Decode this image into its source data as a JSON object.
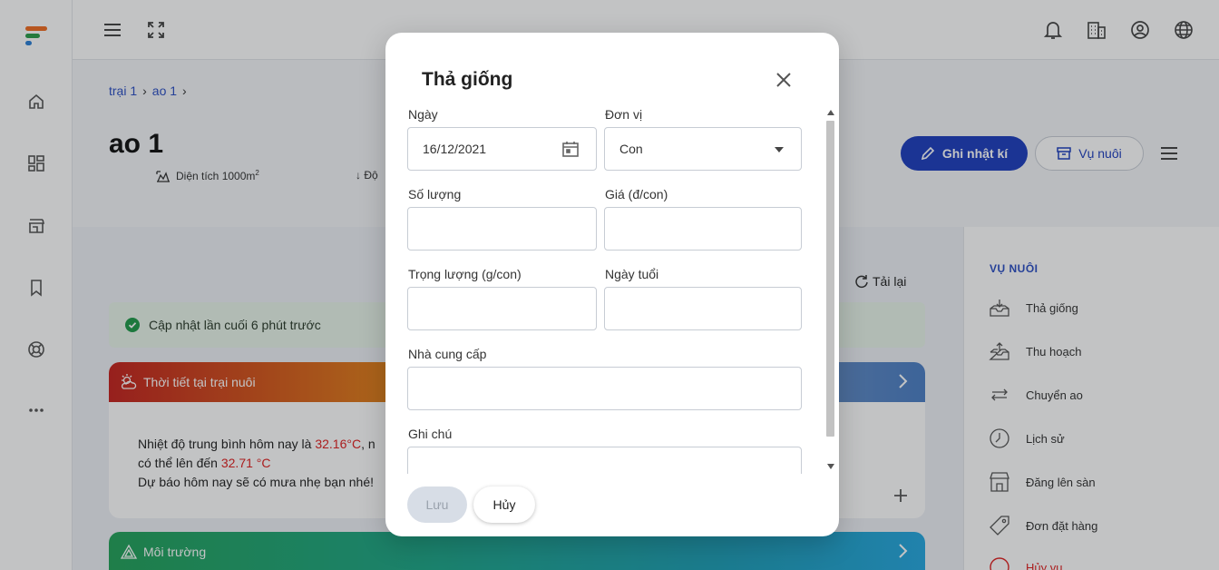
{
  "breadcrumb": {
    "items": [
      "trại 1",
      "ao 1"
    ]
  },
  "pond": {
    "title": "ao 1",
    "area_label": "Diện tích 1000m",
    "area_sup": "2",
    "depth_label": "Độ"
  },
  "header": {
    "log_button": "Ghi nhật kí",
    "season_button": "Vụ nuôi"
  },
  "content": {
    "reload": "Tải lại",
    "updated": "Cập nhật lần cuối 6 phút trước",
    "weather": {
      "title": "Thời tiết tại trại nuôi",
      "line1_pre": "Nhiệt độ trung bình hôm nay là ",
      "line1_temp": "32.16°C",
      "line1_post": ", n",
      "line2_pre": "có thể lên đến ",
      "line2_temp": "32.71 °C",
      "line3": "Dự báo hôm nay sẽ có mưa nhẹ bạn nhé!"
    },
    "environment": {
      "title": "Môi trường"
    }
  },
  "sidebar_panel": {
    "title": "VỤ NUÔI",
    "items": [
      {
        "label": "Thả giống",
        "icon": "stock-release-icon"
      },
      {
        "label": "Thu hoạch",
        "icon": "harvest-icon"
      },
      {
        "label": "Chuyển ao",
        "icon": "transfer-icon"
      },
      {
        "label": "Lịch sử",
        "icon": "history-icon"
      },
      {
        "label": "Đăng lên sàn",
        "icon": "store-icon"
      },
      {
        "label": "Đơn đặt hàng",
        "icon": "tag-icon"
      },
      {
        "label": "Hủy vụ",
        "icon": "cancel-icon"
      }
    ]
  },
  "modal": {
    "title": "Thả giống",
    "fields": {
      "date": {
        "label": "Ngày",
        "value": "16/12/2021"
      },
      "unit": {
        "label": "Đơn vị",
        "value": "Con"
      },
      "quantity": {
        "label": "Số lượng",
        "value": ""
      },
      "price": {
        "label": "Giá (đ/con)",
        "value": ""
      },
      "weight": {
        "label": "Trọng lượng (g/con)",
        "value": ""
      },
      "age": {
        "label": "Ngày tuổi",
        "value": ""
      },
      "supplier": {
        "label": "Nhà cung cấp",
        "value": ""
      },
      "note": {
        "label": "Ghi chú",
        "value": ""
      }
    },
    "save": "Lưu",
    "cancel": "Hủy"
  },
  "colors": {
    "primary": "#1e3fbf",
    "link": "#2c4fc4",
    "danger": "#e02020",
    "success_bg": "#e9f5ea"
  }
}
